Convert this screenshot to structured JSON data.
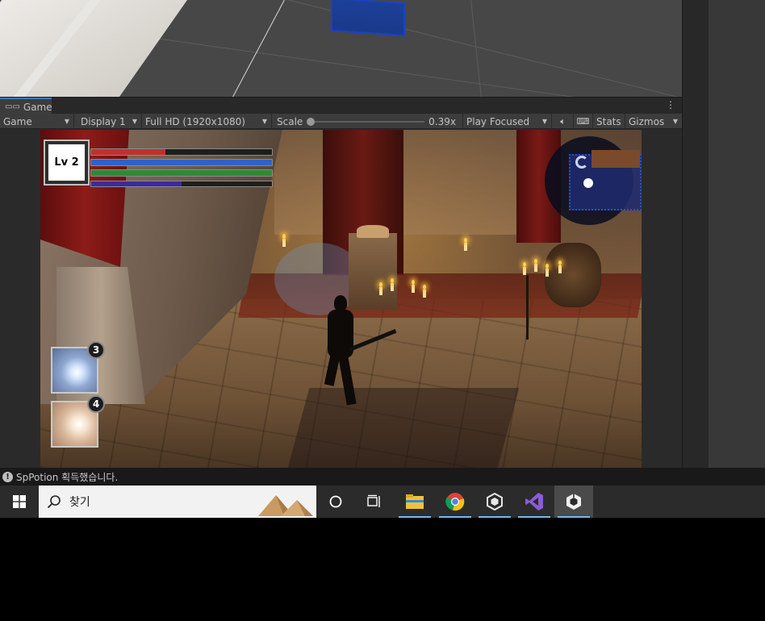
{
  "game_window": {
    "tab_label": "Game",
    "kebab": "⋮",
    "toolbar": {
      "mode": "Game",
      "display": "Display 1",
      "resolution": "Full HD (1920x1080)",
      "scale_label": "Scale",
      "scale_value": "0.39x",
      "play_mode": "Play Focused",
      "stats": "Stats",
      "gizmos": "Gizmos"
    }
  },
  "hud": {
    "level_text": "Lv 2",
    "bars": [
      {
        "name": "hp",
        "fill": 0.41,
        "color": "#c0312c"
      },
      {
        "name": "mp",
        "fill": 1.0,
        "color": "#2e62c9"
      },
      {
        "name": "stamina",
        "fill": 1.0,
        "color": "#2f8a34"
      },
      {
        "name": "exp",
        "fill": 0.5,
        "color": "#3b2a9e"
      }
    ],
    "skills": [
      {
        "key": "3"
      },
      {
        "key": "4"
      }
    ]
  },
  "status_bar": {
    "icon": "!",
    "message": "SpPotion 획득했습니다."
  },
  "taskbar": {
    "search_placeholder": "찾기",
    "apps": [
      "cortana-icon",
      "task-view-icon",
      "file-explorer-icon",
      "chrome-icon",
      "unity-hub-icon",
      "visual-studio-icon",
      "unity-editor-icon"
    ]
  },
  "colors": {
    "editor_bg": "#3c3c3c",
    "tab_accent": "#3a79bb",
    "taskbar": "#2b2b2b"
  }
}
